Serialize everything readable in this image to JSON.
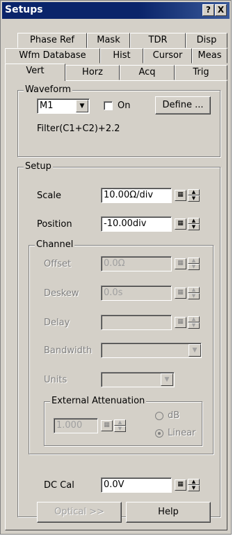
{
  "window": {
    "title": "Setups"
  },
  "titlebar": {
    "help_glyph": "?",
    "close_glyph": "X"
  },
  "tabs": {
    "row1": [
      "Phase Ref",
      "Mask",
      "TDR",
      "Disp"
    ],
    "row2": [
      "Wfm Database",
      "Hist",
      "Cursor",
      "Meas"
    ],
    "row3": [
      "Vert",
      "Horz",
      "Acq",
      "Trig"
    ],
    "active": "Vert"
  },
  "waveform": {
    "legend": "Waveform",
    "selected": "M1",
    "on_label": "On",
    "on_checked": false,
    "define_label": "Define ...",
    "formula": "Filter(C1+C2)+2.2"
  },
  "setup": {
    "legend": "Setup",
    "scale_label": "Scale",
    "scale_value": "10.00Ω/div",
    "position_label": "Position",
    "position_value": "-10.00div"
  },
  "channel": {
    "legend": "Channel",
    "offset_label": "Offset",
    "offset_value": "0.0Ω",
    "deskew_label": "Deskew",
    "deskew_value": "0.0s",
    "delay_label": "Delay",
    "delay_value": "",
    "bandwidth_label": "Bandwidth",
    "bandwidth_value": "",
    "units_label": "Units",
    "units_value": ""
  },
  "attenuation": {
    "legend": "External Attenuation",
    "value": "1.000",
    "option_db": "dB",
    "option_linear": "Linear",
    "selected": "Linear"
  },
  "dc_cal": {
    "label": "DC Cal",
    "value": "0.0V"
  },
  "buttons": {
    "optical": "Optical >>",
    "help": "Help"
  },
  "icons": {
    "keypad": "keypad-icon",
    "spin_up": "▲",
    "spin_down": "▼",
    "dropdown": "▼"
  }
}
